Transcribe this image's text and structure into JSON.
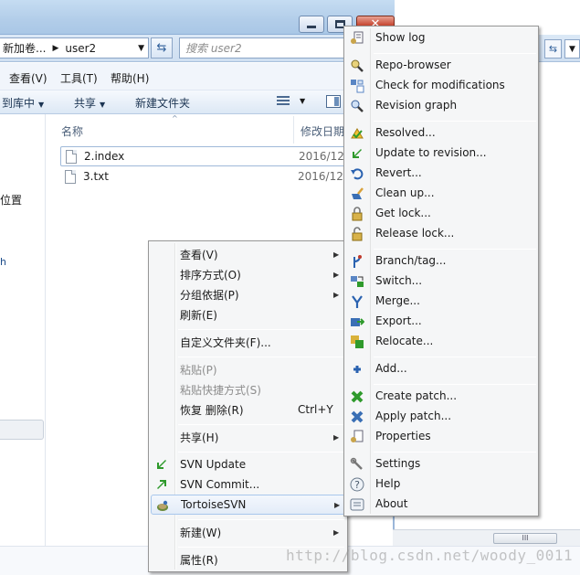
{
  "window": {
    "address": {
      "crumb1": "新加卷...",
      "crumb2": "user2"
    },
    "search_placeholder": "搜索 user2"
  },
  "menubar": {
    "view": "查看(V)",
    "tools": "工具(T)",
    "help": "帮助(H)"
  },
  "toolbar": {
    "include": "到库中",
    "share": "共享",
    "new_folder": "新建文件夹"
  },
  "nav": {
    "location": "位置",
    "h": "h"
  },
  "columns": {
    "name": "名称",
    "date": "修改日期"
  },
  "files": [
    {
      "name": "2.index",
      "date": "2016/12"
    },
    {
      "name": "3.txt",
      "date": "2016/12"
    }
  ],
  "context_menu": {
    "view": "查看(V)",
    "sort": "排序方式(O)",
    "group": "分组依据(P)",
    "refresh": "刷新(E)",
    "customize": "自定义文件夹(F)...",
    "paste": "粘贴(P)",
    "paste_shortcut": "粘贴快捷方式(S)",
    "undo_delete": "恢复 删除(R)",
    "undo_accel": "Ctrl+Y",
    "share": "共享(H)",
    "svn_update": "SVN Update",
    "svn_commit": "SVN Commit...",
    "tortoise": "TortoiseSVN",
    "new": "新建(W)",
    "properties": "属性(R)"
  },
  "tortoise_menu": [
    "Show log",
    "Repo-browser",
    "Check for modifications",
    "Revision graph",
    "Resolved...",
    "Update to revision...",
    "Revert...",
    "Clean up...",
    "Get lock...",
    "Release lock...",
    "Branch/tag...",
    "Switch...",
    "Merge...",
    "Export...",
    "Relocate...",
    "Add...",
    "Create patch...",
    "Apply patch...",
    "Properties",
    "Settings",
    "Help",
    "About"
  ],
  "scrollbar": {
    "grip": "III"
  },
  "watermark": "http://blog.csdn.net/woody_0011",
  "colors": {
    "accent": "#3c7fb1",
    "selection_border": "#a8c7ec",
    "close_button": "#c74a35"
  }
}
